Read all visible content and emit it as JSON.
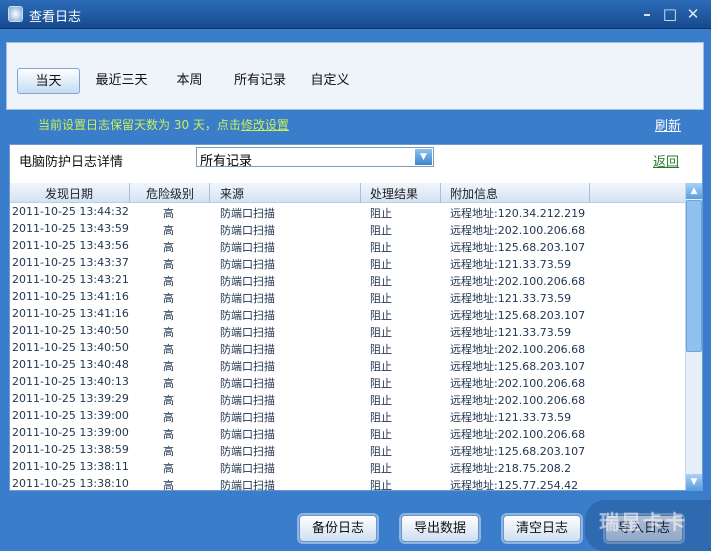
{
  "window": {
    "title": "查看日志",
    "minimize": "–",
    "maximize": "□",
    "close": "✕"
  },
  "tabs": [
    {
      "label": "当天",
      "active": true
    },
    {
      "label": "最近三天"
    },
    {
      "label": "本周"
    },
    {
      "label": "所有记录"
    },
    {
      "label": "自定义"
    }
  ],
  "notice": {
    "text": "当前设置日志保留天数为 30 天，点击",
    "link": "修改设置"
  },
  "refresh": "刷新",
  "detail": {
    "label": "电脑防护日志详情",
    "filter_value": "所有记录",
    "back": "返回"
  },
  "table": {
    "columns": [
      "发现日期",
      "危险级别",
      "来源",
      "处理结果",
      "附加信息"
    ],
    "rows": [
      [
        "2011-10-25 13:44:32",
        "高",
        "防端口扫描",
        "阻止",
        "远程地址:120.34.212.219"
      ],
      [
        "2011-10-25 13:43:59",
        "高",
        "防端口扫描",
        "阻止",
        "远程地址:202.100.206.68"
      ],
      [
        "2011-10-25 13:43:56",
        "高",
        "防端口扫描",
        "阻止",
        "远程地址:125.68.203.107"
      ],
      [
        "2011-10-25 13:43:37",
        "高",
        "防端口扫描",
        "阻止",
        "远程地址:121.33.73.59"
      ],
      [
        "2011-10-25 13:43:21",
        "高",
        "防端口扫描",
        "阻止",
        "远程地址:202.100.206.68"
      ],
      [
        "2011-10-25 13:41:16",
        "高",
        "防端口扫描",
        "阻止",
        "远程地址:121.33.73.59"
      ],
      [
        "2011-10-25 13:41:16",
        "高",
        "防端口扫描",
        "阻止",
        "远程地址:125.68.203.107"
      ],
      [
        "2011-10-25 13:40:50",
        "高",
        "防端口扫描",
        "阻止",
        "远程地址:121.33.73.59"
      ],
      [
        "2011-10-25 13:40:50",
        "高",
        "防端口扫描",
        "阻止",
        "远程地址:202.100.206.68"
      ],
      [
        "2011-10-25 13:40:48",
        "高",
        "防端口扫描",
        "阻止",
        "远程地址:125.68.203.107"
      ],
      [
        "2011-10-25 13:40:13",
        "高",
        "防端口扫描",
        "阻止",
        "远程地址:202.100.206.68"
      ],
      [
        "2011-10-25 13:39:29",
        "高",
        "防端口扫描",
        "阻止",
        "远程地址:202.100.206.68"
      ],
      [
        "2011-10-25 13:39:00",
        "高",
        "防端口扫描",
        "阻止",
        "远程地址:121.33.73.59"
      ],
      [
        "2011-10-25 13:39:00",
        "高",
        "防端口扫描",
        "阻止",
        "远程地址:202.100.206.68"
      ],
      [
        "2011-10-25 13:38:59",
        "高",
        "防端口扫描",
        "阻止",
        "远程地址:125.68.203.107"
      ],
      [
        "2011-10-25 13:38:11",
        "高",
        "防端口扫描",
        "阻止",
        "远程地址:218.75.208.2"
      ],
      [
        "2011-10-25 13:38:10",
        "高",
        "防端口扫描",
        "阻止",
        "远程地址:125.77.254.42"
      ]
    ]
  },
  "buttons": {
    "backup": "备份日志",
    "export": "导出数据",
    "clear": "清空日志",
    "import": "导入日志"
  },
  "watermark": "瑞星卡卡",
  "colors": {
    "background": "#3a7dca",
    "notice": "#c9f05a",
    "titlebar": "#164a8e"
  }
}
